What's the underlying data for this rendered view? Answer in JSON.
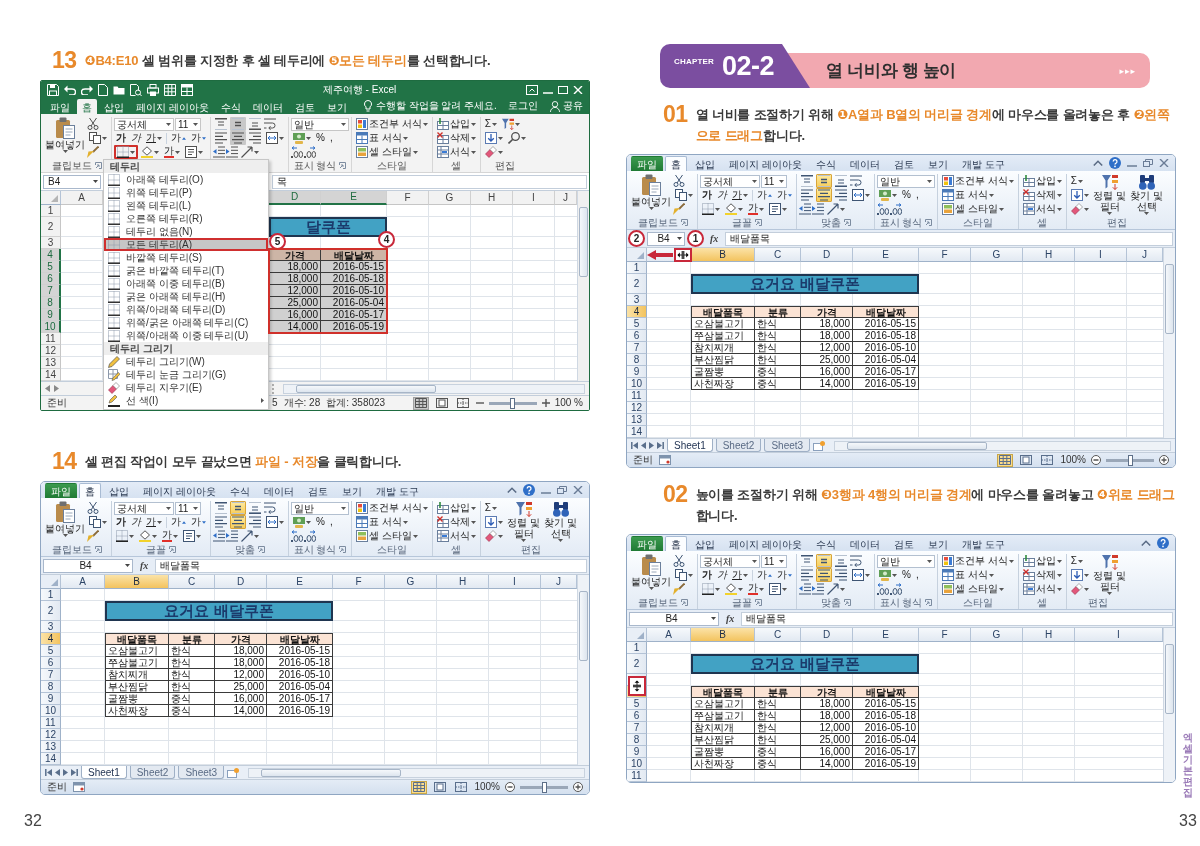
{
  "left_page": {
    "steps": [
      {
        "number": "13",
        "text": "**❹B4:E10** 셀 범위를 지정한 후 셀 테두리에 **❺모든 테두리**를 선택합니다.",
        "screenshot": {
          "kind": "excel2016",
          "title": "제주여행 - Excel",
          "tabs": [
            {
              "kind": "file",
              "label": "파일",
              "selected": false
            },
            {
              "kind": "tab",
              "label": "홈",
              "selected": true
            },
            {
              "kind": "tab",
              "label": "삽입",
              "selected": false
            },
            {
              "kind": "tab",
              "label": "페이지 레이아웃",
              "selected": false
            },
            {
              "kind": "tab",
              "label": "수식",
              "selected": false
            },
            {
              "kind": "tab",
              "label": "데이터",
              "selected": false
            },
            {
              "kind": "tab",
              "label": "검토",
              "selected": false
            },
            {
              "kind": "tab",
              "label": "보기",
              "selected": false
            }
          ],
          "tell_me": "수행할 작업을 알려 주세요.",
          "sign_in": "로그인",
          "share": "공유",
          "ribbon": {
            "clipboard": {
              "paste": "붙여넣기",
              "label": "클립보드"
            },
            "font": {
              "name": "궁서체",
              "size": "11",
              "styles": [
                "가",
                "가",
                "가"
              ],
              "sizers": [
                "가",
                "가"
              ],
              "color_letter": "가",
              "border_highlighted": true
            },
            "alignment": {
              "buttons": [
                {
                  "selected": false
                },
                {
                  "selected": true
                },
                {
                  "selected": false
                },
                {
                  "selected": false
                },
                {
                  "selected": true
                },
                {
                  "selected": false
                }
              ]
            },
            "number": {
              "format": "일반",
              "symbols": [
                "%",
                ","
              ],
              "label": "표시 형식"
            },
            "styles": {
              "items": [
                "조건부 서식",
                "표 서식",
                "셀 스타일"
              ],
              "label": "스타일"
            },
            "cells": {
              "items": [
                "삽입",
                "삭제",
                "서식"
              ],
              "label": "셀"
            },
            "editing": {
              "sum": "Σ",
              "label": "편집"
            }
          },
          "name_box": "B4",
          "formula": "목",
          "columns": [
            {
              "label": "A",
              "selected": false
            },
            {
              "label": "D",
              "selected": true
            },
            {
              "label": "E",
              "selected": true
            },
            {
              "label": "F",
              "selected": false
            },
            {
              "label": "G",
              "selected": false
            },
            {
              "label": "H",
              "selected": false
            },
            {
              "label": "I",
              "selected": false
            },
            {
              "label": "J",
              "selected": false
            }
          ],
          "rows": [
            {
              "label": "1",
              "selected": false
            },
            {
              "label": "2",
              "selected": false
            },
            {
              "label": "3",
              "selected": false
            },
            {
              "label": "4",
              "selected": true
            },
            {
              "label": "5",
              "selected": true
            },
            {
              "label": "6",
              "selected": true
            },
            {
              "label": "7",
              "selected": true
            },
            {
              "label": "8",
              "selected": true
            },
            {
              "label": "9",
              "selected": true
            },
            {
              "label": "10",
              "selected": true
            },
            {
              "label": "11",
              "selected": false
            },
            {
              "label": "12",
              "selected": false
            },
            {
              "label": "13",
              "selected": false
            },
            {
              "label": "14",
              "selected": false
            }
          ],
          "table": {
            "title": "달쿠폰",
            "header": [
              {
                "label": "가격",
                "kind": "number"
              },
              {
                "label": "배달날짜",
                "kind": "number"
              }
            ],
            "rows": [
              [
                "18,000",
                "2016-05-15"
              ],
              [
                "18,000",
                "2016-05-18"
              ],
              [
                "12,000",
                "2016-05-10"
              ],
              [
                "25,000",
                "2016-05-04"
              ],
              [
                "16,000",
                "2016-05-17"
              ],
              [
                "14,000",
                "2016-05-19"
              ]
            ],
            "selected": true
          },
          "range_highlighted": true,
          "border_menu": {
            "items": [
              {
                "kind": "header",
                "label": "테두리"
              },
              {
                "kind": "border",
                "label": "아래쪽 테두리(O)",
                "selected": false
              },
              {
                "kind": "border",
                "label": "위쪽 테두리(P)",
                "selected": false
              },
              {
                "kind": "border",
                "label": "왼쪽 테두리(L)",
                "selected": false
              },
              {
                "kind": "border",
                "label": "오른쪽 테두리(R)",
                "selected": false
              },
              {
                "kind": "border",
                "label": "테두리 없음(N)",
                "selected": false
              },
              {
                "kind": "border",
                "label": "모든 테두리(A)",
                "selected": true
              },
              {
                "kind": "border",
                "label": "바깥쪽 테두리(S)",
                "selected": false
              },
              {
                "kind": "border",
                "label": "굵은 바깥쪽 테두리(T)",
                "selected": false
              },
              {
                "kind": "border",
                "label": "아래쪽 이중 테두리(B)",
                "selected": false
              },
              {
                "kind": "border",
                "label": "굵은 아래쪽 테두리(H)",
                "selected": false
              },
              {
                "kind": "border",
                "label": "위쪽/아래쪽 테두리(D)",
                "selected": false
              },
              {
                "kind": "border",
                "label": "위쪽/굵은 아래쪽 테두리(C)",
                "selected": false
              },
              {
                "kind": "border",
                "label": "위쪽/아래쪽 이중 테두리(U)",
                "selected": false
              },
              {
                "kind": "header",
                "label": "테두리 그리기"
              },
              {
                "kind": "draw",
                "label": "테두리 그리기(W)",
                "selected": false
              },
              {
                "kind": "grid",
                "label": "테두리 눈금 그리기(G)",
                "selected": false
              },
              {
                "kind": "erase",
                "label": "테두리 지우기(E)",
                "selected": false
              },
              {
                "kind": "submenu",
                "label": "선 색(I)",
                "selected": false
              }
            ]
          },
          "callouts": [
            {
              "kind": "menu_item",
              "label": "5"
            },
            {
              "kind": "range",
              "label": "4"
            }
          ],
          "status": {
            "ready": "준비",
            "stats": [
              "5",
              "개수: 28",
              "합계: 358023"
            ],
            "views": [
              {
                "selected": true
              },
              {
                "selected": false
              },
              {
                "selected": false
              }
            ],
            "zoom": "100 %",
            "zoom_slider": {
              "level": 0.5
            }
          }
        }
      },
      {
        "number": "14",
        "text": "셀 편집 작업이 모두 끝났으면 **파일 - 저장**을 클릭합니다.",
        "screenshot": {
          "kind": "excel2010",
          "tabs": [
            {
              "kind": "file",
              "label": "파일",
              "selected": false
            },
            {
              "kind": "tab",
              "label": "홈",
              "selected": true
            },
            {
              "kind": "tab",
              "label": "삽입",
              "selected": false
            },
            {
              "kind": "tab",
              "label": "페이지 레이아웃",
              "selected": false
            },
            {
              "kind": "tab",
              "label": "수식",
              "selected": false
            },
            {
              "kind": "tab",
              "label": "데이터",
              "selected": false
            },
            {
              "kind": "tab",
              "label": "검토",
              "selected": false
            },
            {
              "kind": "tab",
              "label": "보기",
              "selected": false
            },
            {
              "kind": "tab",
              "label": "개발 도구",
              "selected": false
            }
          ],
          "window_controls": true,
          "ribbon": {
            "clipboard": {
              "paste": "붙여넣기",
              "label": "클립보드"
            },
            "font": {
              "name": "궁서체",
              "size": "11",
              "styles": [
                "가",
                "가",
                "가"
              ],
              "sizers": [
                "가",
                "가"
              ],
              "color_letter": "가",
              "label": "글꼴"
            },
            "alignment": {
              "buttons": [
                {
                  "selected": false
                },
                {
                  "selected": true
                },
                {
                  "selected": false
                },
                {
                  "selected": false
                },
                {
                  "selected": true
                },
                {
                  "selected": false
                }
              ],
              "label": "맞춤"
            },
            "number": {
              "format": "일반",
              "symbols": [
                "%",
                ","
              ],
              "label": "표시 형식"
            },
            "styles": {
              "items": [
                "조건부 서식",
                "표 서식",
                "셀 스타일"
              ],
              "label": "스타일"
            },
            "cells": {
              "items": [
                "삽입",
                "삭제",
                "서식"
              ],
              "label": "셀"
            },
            "editing": {
              "sum": "Σ",
              "items": [
                "정렬 및 필터",
                "찾기 및 선택"
              ],
              "label": "편집"
            }
          },
          "name_box": "B4",
          "fx": "fx",
          "formula": "배달품목",
          "columns": [
            {
              "label": "A",
              "selected": false
            },
            {
              "label": "B",
              "selected": true
            },
            {
              "label": "C",
              "selected": false
            },
            {
              "label": "D",
              "selected": false
            },
            {
              "label": "E",
              "selected": false
            },
            {
              "label": "F",
              "selected": false
            },
            {
              "label": "G",
              "selected": false
            },
            {
              "label": "H",
              "selected": false
            },
            {
              "label": "I",
              "selected": false
            },
            {
              "label": "J",
              "selected": false
            }
          ],
          "rows": [
            {
              "label": "1",
              "selected": false
            },
            {
              "label": "2",
              "selected": false
            },
            {
              "label": "3",
              "selected": false
            },
            {
              "label": "4",
              "selected": true
            },
            {
              "label": "5",
              "selected": false
            },
            {
              "label": "6",
              "selected": false
            },
            {
              "label": "7",
              "selected": false
            },
            {
              "label": "8",
              "selected": false
            },
            {
              "label": "9",
              "selected": false
            },
            {
              "label": "10",
              "selected": false
            },
            {
              "label": "11",
              "selected": false
            },
            {
              "label": "12",
              "selected": false
            },
            {
              "label": "13",
              "selected": false
            },
            {
              "label": "14",
              "selected": false
            }
          ],
          "table": {
            "title": "요거요 배달쿠폰",
            "header": [
              {
                "label": "배달품목",
                "kind": "text"
              },
              {
                "label": "분류",
                "kind": "text"
              },
              {
                "label": "가격",
                "kind": "number"
              },
              {
                "label": "배달날짜",
                "kind": "number"
              }
            ],
            "rows": [
              [
                "오삼불고기",
                "한식",
                "18,000",
                "2016-05-15"
              ],
              [
                "쭈삼불고기",
                "한식",
                "18,000",
                "2016-05-18"
              ],
              [
                "참치찌개",
                "한식",
                "12,000",
                "2016-05-10"
              ],
              [
                "부산찜닭",
                "한식",
                "25,000",
                "2016-05-04"
              ],
              [
                "굴짬뽕",
                "중식",
                "16,000",
                "2016-05-17"
              ],
              [
                "사천짜장",
                "중식",
                "14,000",
                "2016-05-19"
              ]
            ],
            "selected": false
          },
          "sheet_tabs": [
            {
              "label": "Sheet1",
              "selected": true
            },
            {
              "label": "Sheet2",
              "selected": false
            },
            {
              "label": "Sheet3",
              "selected": false
            }
          ],
          "status": {
            "ready": "준비",
            "views": [
              {
                "selected": true
              },
              {
                "selected": false
              },
              {
                "selected": false
              }
            ],
            "zoom": "100%",
            "zoom_slider": {
              "level": 0.5
            }
          }
        }
      }
    ],
    "page_number": "32"
  },
  "right_page": {
    "chapter": {
      "label": "CHAPTER",
      "number": "02-2",
      "title": "열 너비와 행 높이",
      "arrows": "▸▸▸"
    },
    "steps": [
      {
        "number": "01",
        "text": "열 너비를 조절하기 위해 **❶A열과 B열의 머리글 경계**에 마우스를 올려놓은 후 **❷왼쪽으로 드래그**합니다.",
        "screenshot": {
          "kind": "excel2010",
          "tabs": [
            {
              "kind": "file",
              "label": "파일",
              "selected": false
            },
            {
              "kind": "tab",
              "label": "홈",
              "selected": true
            },
            {
              "kind": "tab",
              "label": "삽입",
              "selected": false
            },
            {
              "kind": "tab",
              "label": "페이지 레이아웃",
              "selected": false
            },
            {
              "kind": "tab",
              "label": "수식",
              "selected": false
            },
            {
              "kind": "tab",
              "label": "데이터",
              "selected": false
            },
            {
              "kind": "tab",
              "label": "검토",
              "selected": false
            },
            {
              "kind": "tab",
              "label": "보기",
              "selected": false
            },
            {
              "kind": "tab",
              "label": "개발 도구",
              "selected": false
            }
          ],
          "window_controls": true,
          "ribbon": {
            "clipboard": {
              "paste": "붙여넣기",
              "label": "클립보드"
            },
            "font": {
              "name": "궁서체",
              "size": "11",
              "styles": [
                "가",
                "가",
                "가"
              ],
              "sizers": [
                "가",
                "가"
              ],
              "color_letter": "가",
              "label": "글꼴"
            },
            "alignment": {
              "buttons": [
                {
                  "selected": false
                },
                {
                  "selected": true
                },
                {
                  "selected": false
                },
                {
                  "selected": false
                },
                {
                  "selected": true
                },
                {
                  "selected": false
                }
              ],
              "label": "맞춤"
            },
            "number": {
              "format": "일반",
              "symbols": [
                "%",
                ","
              ],
              "label": "표시 형식"
            },
            "styles": {
              "items": [
                "조건부 서식",
                "표 서식",
                "셀 스타일"
              ],
              "label": "스타일"
            },
            "cells": {
              "items": [
                "삽입",
                "삭제",
                "서식"
              ],
              "label": "셀"
            },
            "editing": {
              "sum": "Σ",
              "items": [
                "정렬 및 필터",
                "찾기 및 선택"
              ],
              "label": "편집"
            }
          },
          "name_box": "B4",
          "fx": "fx",
          "formula": "배달품목",
          "columns": [
            {
              "selected": false
            },
            {
              "label": "B",
              "selected": true
            },
            {
              "label": "C",
              "selected": false
            },
            {
              "label": "D",
              "selected": false
            },
            {
              "label": "E",
              "selected": false
            },
            {
              "label": "F",
              "selected": false
            },
            {
              "label": "G",
              "selected": false
            },
            {
              "label": "H",
              "selected": false
            },
            {
              "label": "I",
              "selected": false
            },
            {
              "label": "J",
              "selected": false
            }
          ],
          "rows": [
            {
              "label": "1",
              "selected": false
            },
            {
              "label": "2",
              "selected": false
            },
            {
              "label": "3",
              "selected": false
            },
            {
              "label": "4",
              "selected": true
            },
            {
              "label": "5",
              "selected": false
            },
            {
              "label": "6",
              "selected": false
            },
            {
              "label": "7",
              "selected": false
            },
            {
              "label": "8",
              "selected": false
            },
            {
              "label": "9",
              "selected": false
            },
            {
              "label": "10",
              "selected": false
            },
            {
              "label": "11",
              "selected": false
            },
            {
              "label": "12",
              "selected": false
            },
            {
              "label": "13",
              "selected": false
            },
            {
              "label": "14",
              "selected": false
            }
          ],
          "table": {
            "title": "요거요 배달쿠폰",
            "header": [
              {
                "label": "배달품목",
                "kind": "text"
              },
              {
                "label": "분류",
                "kind": "text"
              },
              {
                "label": "가격",
                "kind": "number"
              },
              {
                "label": "배달날짜",
                "kind": "number"
              }
            ],
            "rows": [
              [
                "오삼불고기",
                "한식",
                "18,000",
                "2016-05-15"
              ],
              [
                "쭈삼불고기",
                "한식",
                "18,000",
                "2016-05-18"
              ],
              [
                "참치찌개",
                "한식",
                "12,000",
                "2016-05-10"
              ],
              [
                "부산찜닭",
                "한식",
                "25,000",
                "2016-05-04"
              ],
              [
                "굴짬뽕",
                "중식",
                "16,000",
                "2016-05-17"
              ],
              [
                "사천짜장",
                "중식",
                "14,000",
                "2016-05-19"
              ]
            ],
            "selected": false
          },
          "cursor": {
            "kind": "column_resize"
          },
          "drag_arrow": true,
          "callouts": [
            {
              "kind": "name_box",
              "label": "2"
            },
            {
              "kind": "column_boundary",
              "label": "1"
            }
          ],
          "sheet_tabs": [
            {
              "label": "Sheet1",
              "selected": true
            },
            {
              "label": "Sheet2",
              "selected": false
            },
            {
              "label": "Sheet3",
              "selected": false
            }
          ],
          "status": {
            "ready": "준비",
            "views": [
              {
                "selected": true
              },
              {
                "selected": false
              },
              {
                "selected": false
              }
            ],
            "zoom": "100%",
            "zoom_slider": {
              "level": 0.5
            }
          }
        }
      },
      {
        "number": "02",
        "text": "높이를 조절하기 위해 **❸3행과 4행의 머리글 경계**에 마우스를 올려놓고 **❹위로 드래그**합니다.",
        "screenshot": {
          "kind": "excel2010",
          "tabs": [
            {
              "kind": "file",
              "label": "파일",
              "selected": false
            },
            {
              "kind": "tab",
              "label": "홈",
              "selected": true
            },
            {
              "kind": "tab",
              "label": "삽입",
              "selected": false
            },
            {
              "kind": "tab",
              "label": "페이지 레이아웃",
              "selected": false
            },
            {
              "kind": "tab",
              "label": "수식",
              "selected": false
            },
            {
              "kind": "tab",
              "label": "데이터",
              "selected": false
            },
            {
              "kind": "tab",
              "label": "검토",
              "selected": false
            },
            {
              "kind": "tab",
              "label": "보기",
              "selected": false
            },
            {
              "kind": "tab",
              "label": "개발 도구",
              "selected": false
            }
          ],
          "ribbon": {
            "clipboard": {
              "paste": "붙여넣기",
              "label": "클립보드"
            },
            "font": {
              "name": "궁서체",
              "size": "11",
              "styles": [
                "가",
                "가",
                "가"
              ],
              "sizers": [
                "가",
                "가"
              ],
              "color_letter": "가",
              "label": "글꼴"
            },
            "alignment": {
              "buttons": [
                {
                  "selected": false
                },
                {
                  "selected": true
                },
                {
                  "selected": false
                },
                {
                  "selected": false
                },
                {
                  "selected": true
                },
                {
                  "selected": false
                }
              ],
              "label": "맞춤"
            },
            "number": {
              "format": "일반",
              "symbols": [
                "%",
                ","
              ],
              "label": "표시 형식"
            },
            "styles": {
              "items": [
                "조건부 서식",
                "표 서식",
                "셀 스타일"
              ],
              "label": "스타일"
            },
            "cells": {
              "items": [
                "삽입",
                "삭제",
                "서식"
              ],
              "label": "셀"
            },
            "editing": {
              "sum": "Σ",
              "items": [
                "정렬 및 필터"
              ],
              "label": "편집"
            }
          },
          "name_box": "B4",
          "fx": "fx",
          "formula": "배달품목",
          "columns": [
            {
              "label": "A",
              "selected": false
            },
            {
              "label": "B",
              "selected": true
            },
            {
              "label": "C",
              "selected": false
            },
            {
              "label": "D",
              "selected": false
            },
            {
              "label": "E",
              "selected": false
            },
            {
              "label": "F",
              "selected": false
            },
            {
              "label": "G",
              "selected": false
            },
            {
              "label": "H",
              "selected": false
            },
            {
              "label": "I",
              "selected": false
            }
          ],
          "rows": [
            {
              "label": "1",
              "selected": false
            },
            {
              "label": "2",
              "selected": false
            },
            {
              "selected": false
            },
            {
              "selected": true
            },
            {
              "label": "5",
              "selected": false
            },
            {
              "label": "6",
              "selected": false
            },
            {
              "label": "7",
              "selected": false
            },
            {
              "label": "8",
              "selected": false
            },
            {
              "label": "9",
              "selected": false
            },
            {
              "label": "10",
              "selected": false
            },
            {
              "label": "11",
              "selected": false
            }
          ],
          "table": {
            "title": "요거요 배달쿠폰",
            "header": [
              {
                "label": "배달품목",
                "kind": "text"
              },
              {
                "label": "분류",
                "kind": "text"
              },
              {
                "label": "가격",
                "kind": "number"
              },
              {
                "label": "배달날짜",
                "kind": "number"
              }
            ],
            "rows": [
              [
                "오삼불고기",
                "한식",
                "18,000",
                "2016-05-15"
              ],
              [
                "쭈삼불고기",
                "한식",
                "18,000",
                "2016-05-18"
              ],
              [
                "참치찌개",
                "한식",
                "12,000",
                "2016-05-10"
              ],
              [
                "부산찜닭",
                "한식",
                "25,000",
                "2016-05-04"
              ],
              [
                "굴짬뽕",
                "중식",
                "16,000",
                "2016-05-17"
              ],
              [
                "사천짜장",
                "중식",
                "14,000",
                "2016-05-19"
              ]
            ],
            "selected": false
          },
          "cursor": {
            "kind": "row_resize"
          }
        }
      }
    ],
    "side_tab": "엑셀 기본 편집",
    "page_number": "33"
  }
}
